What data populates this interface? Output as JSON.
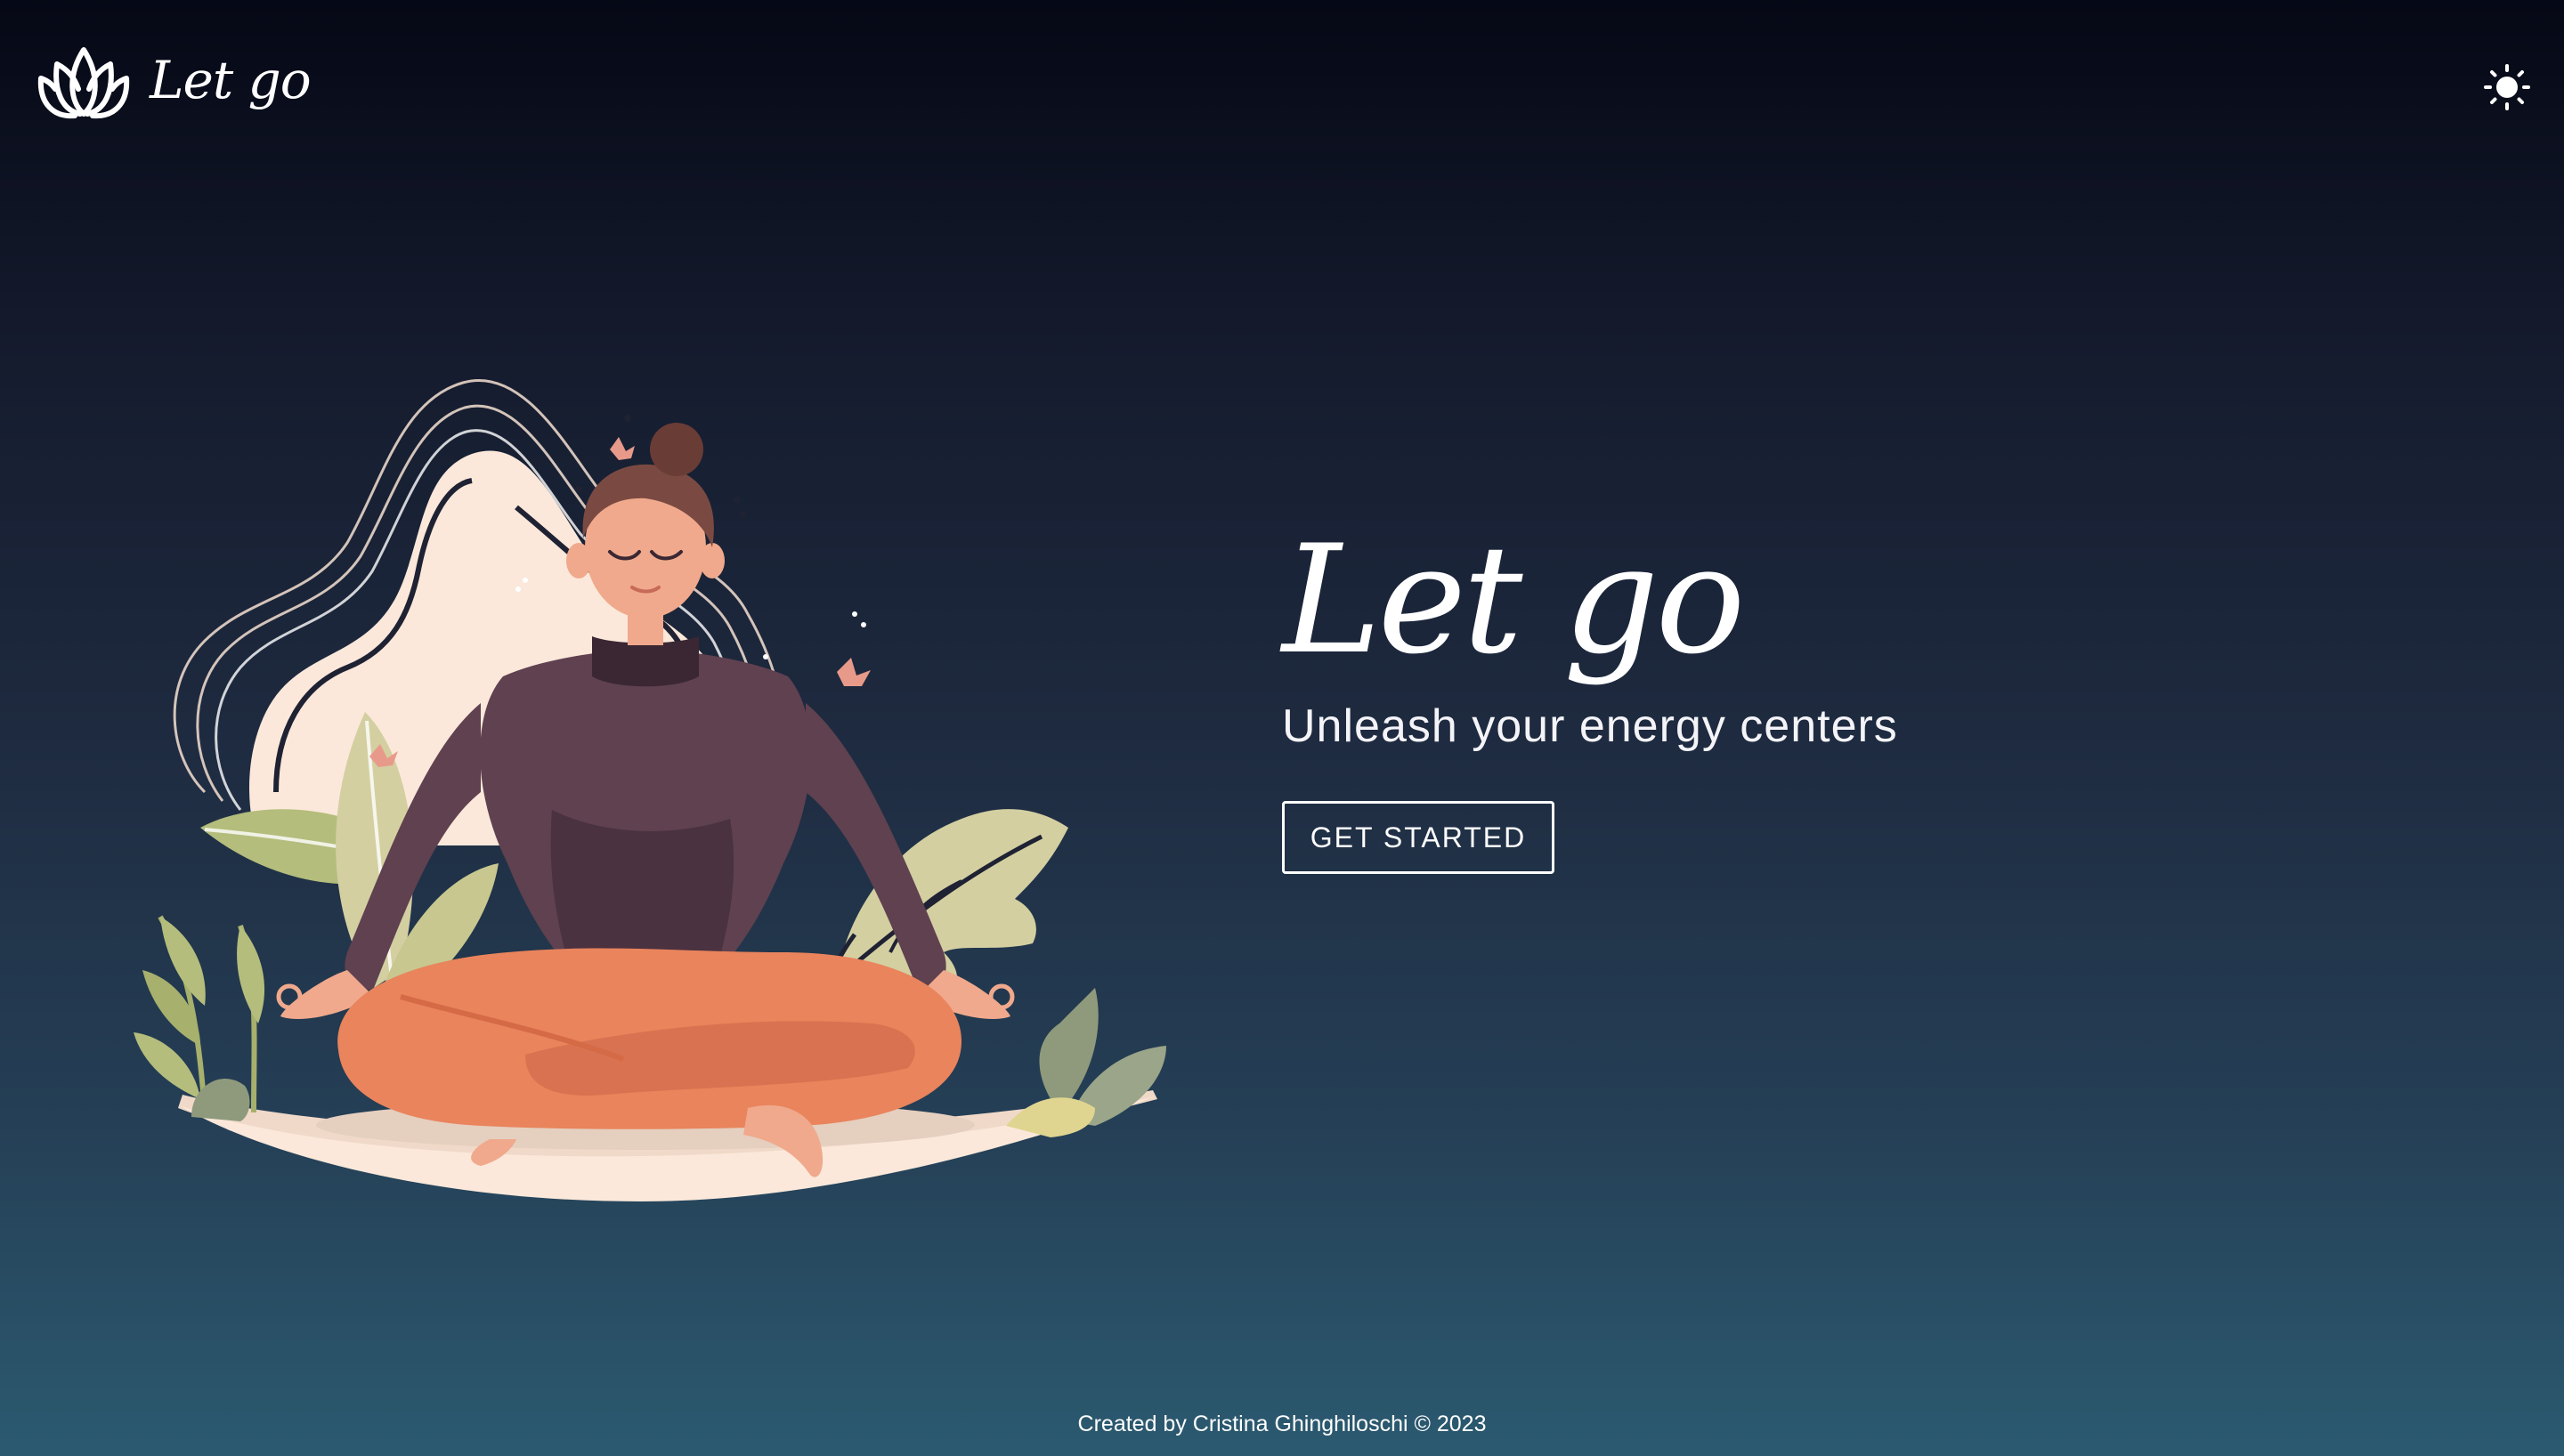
{
  "header": {
    "brand_name": "Let go",
    "logo_icon": "lotus-icon",
    "theme_toggle_icon": "sun-icon"
  },
  "hero": {
    "title": "Let go",
    "subtitle": "Unleash your energy centers",
    "cta_label": "GET STARTED",
    "illustration": "meditating-woman-illustration"
  },
  "footer": {
    "credit": "Created by Cristina Ghinghiloschi © 2023"
  },
  "colors": {
    "background_top": "#050815",
    "background_bottom": "#2b5a70",
    "text": "#ffffff",
    "illustration_cream": "#fbe8da",
    "sweater": "#5f4150",
    "pants": "#e9845c",
    "leaf_green": "#b4bd7c"
  }
}
